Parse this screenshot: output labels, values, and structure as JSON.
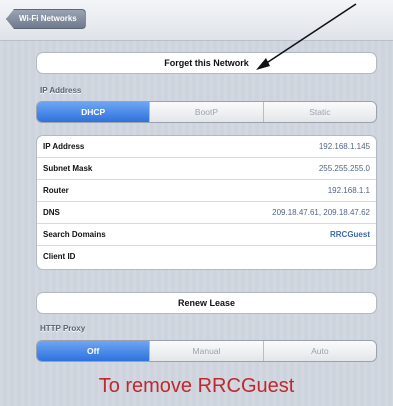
{
  "nav": {
    "back_label": "Wi-Fi Networks"
  },
  "forget_button": "Forget this Network",
  "ip_section": {
    "label": "IP Address",
    "modes": [
      "DHCP",
      "BootP",
      "Static"
    ],
    "selected": "DHCP"
  },
  "details": [
    {
      "label": "IP Address",
      "value": "192.168.1.145"
    },
    {
      "label": "Subnet Mask",
      "value": "255.255.255.0"
    },
    {
      "label": "Router",
      "value": "192.168.1.1"
    },
    {
      "label": "DNS",
      "value": "209.18.47.61, 209.18.47.62"
    },
    {
      "label": "Search Domains",
      "value": "RRCGuest"
    },
    {
      "label": "Client ID",
      "value": ""
    }
  ],
  "renew_button": "Renew Lease",
  "proxy_section": {
    "label": "HTTP Proxy",
    "modes": [
      "Off",
      "Manual",
      "Auto"
    ],
    "selected": "Off"
  },
  "annotation": {
    "caption": "To remove RRCGuest",
    "color": "#c0282d"
  },
  "colors": {
    "selected_segment": "#2e72dc",
    "value_text": "#536584"
  }
}
